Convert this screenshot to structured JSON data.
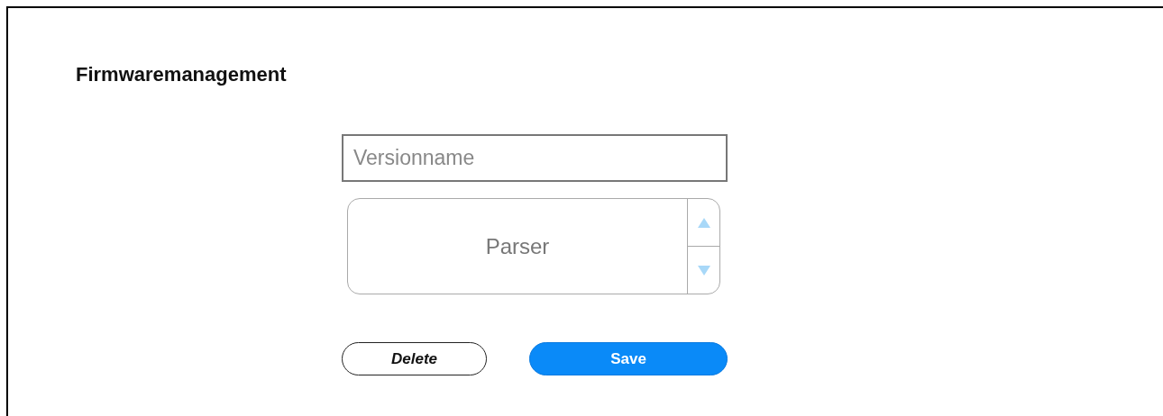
{
  "title": "Firmwaremanagement",
  "version_field": {
    "placeholder": "Versionname"
  },
  "parser_spinner": {
    "value": "Parser"
  },
  "buttons": [
    {
      "label": "Delete",
      "kind": "secondary"
    },
    {
      "label": "Save",
      "kind": "primary"
    }
  ]
}
